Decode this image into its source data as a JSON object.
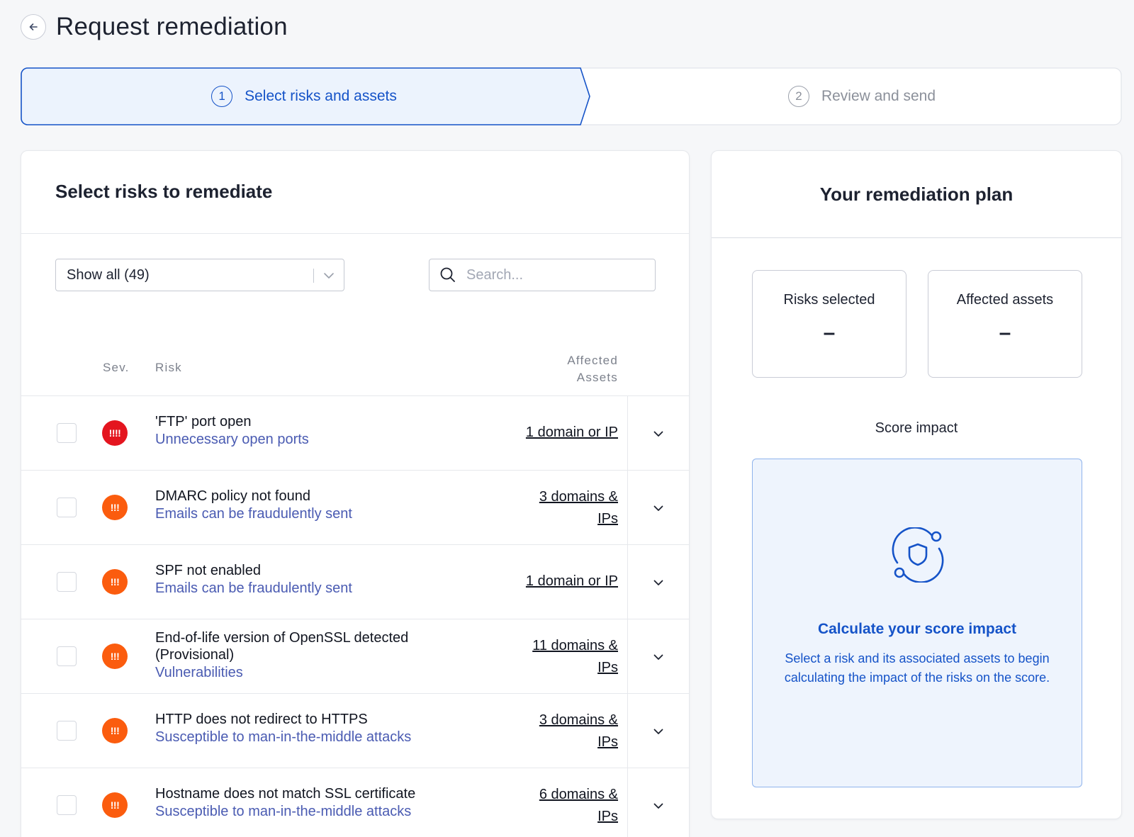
{
  "header": {
    "title": "Request remediation"
  },
  "stepper": {
    "steps": [
      {
        "number": "1",
        "label": "Select risks and assets"
      },
      {
        "number": "2",
        "label": "Review and send"
      }
    ]
  },
  "risks_panel": {
    "title": "Select risks to remediate",
    "filter": {
      "selected": "Show all (49)"
    },
    "search": {
      "placeholder": "Search..."
    },
    "columns": {
      "severity": "Sev.",
      "risk": "Risk",
      "assets_line1": "Affected",
      "assets_line2": "Assets"
    },
    "rows": [
      {
        "severity": "critical",
        "severity_icon": "!!!!",
        "title": "'FTP' port open",
        "title_line2": "",
        "category": "Unnecessary open ports",
        "assets_line1": "1 domain or IP",
        "assets_line2": ""
      },
      {
        "severity": "high",
        "severity_icon": "!!!",
        "title": "DMARC policy not found",
        "title_line2": "",
        "category": "Emails can be fraudulently sent",
        "assets_line1": "3 domains &",
        "assets_line2": "IPs"
      },
      {
        "severity": "high",
        "severity_icon": "!!!",
        "title": "SPF not enabled",
        "title_line2": "",
        "category": "Emails can be fraudulently sent",
        "assets_line1": "1 domain or IP",
        "assets_line2": ""
      },
      {
        "severity": "high",
        "severity_icon": "!!!",
        "title": "End-of-life version of OpenSSL detected",
        "title_line2": "(Provisional)",
        "category": "Vulnerabilities",
        "assets_line1": "11 domains &",
        "assets_line2": "IPs"
      },
      {
        "severity": "high",
        "severity_icon": "!!!",
        "title": "HTTP does not redirect to HTTPS",
        "title_line2": "",
        "category": "Susceptible to man-in-the-middle attacks",
        "assets_line1": "3 domains &",
        "assets_line2": "IPs"
      },
      {
        "severity": "high",
        "severity_icon": "!!!",
        "title": "Hostname does not match SSL certificate",
        "title_line2": "",
        "category": "Susceptible to man-in-the-middle attacks",
        "assets_line1": "6 domains &",
        "assets_line2": "IPs"
      }
    ]
  },
  "plan_panel": {
    "title": "Your remediation plan",
    "risks_selected": {
      "label": "Risks selected",
      "value": "–"
    },
    "affected_assets": {
      "label": "Affected assets",
      "value": "–"
    },
    "score_impact": {
      "label": "Score impact",
      "title": "Calculate your score impact",
      "description": "Select a risk and its associated assets to begin calculating the impact of the risks on the score."
    }
  },
  "colors": {
    "accent": "#1553c8",
    "critical": "#e4151f",
    "high": "#fb5c0e",
    "category_text": "#4a5bb2"
  }
}
